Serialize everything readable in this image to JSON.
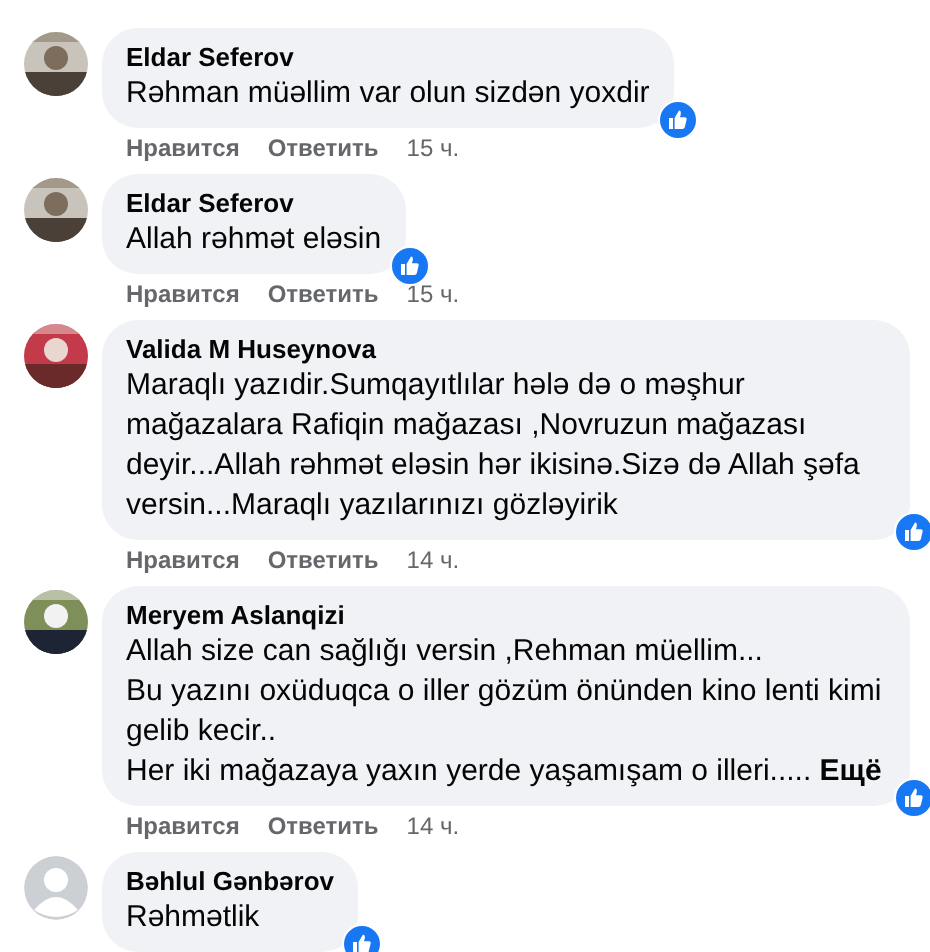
{
  "comments": [
    {
      "author": "Eldar Seferov",
      "photo": true,
      "text": "Rəhman müəllim var olun sizdən yoxdir",
      "liked": true,
      "like": "Нравится",
      "reply": "Ответить",
      "time": "15 ч."
    },
    {
      "author": "Eldar Seferov",
      "photo": true,
      "text": "Allah rəhmət eləsin",
      "liked": true,
      "like": "Нравится",
      "reply": "Ответить",
      "time": "15 ч."
    },
    {
      "author": "Valida M Huseynova",
      "photo": true,
      "text": "Maraqlı yazıdir.Sumqayıtlılar hələ də o məşhur mağazalara Rafiqin mağazası ,Novruzun mağazası deyir...Allah rəhmət eləsin hər ikisinə.Sizə də Allah şəfa versin...Maraqlı yazılarınızı gözləyirik",
      "liked": true,
      "like": "Нравится",
      "reply": "Ответить",
      "time": "14 ч."
    },
    {
      "author": "Meryem Aslanqizi",
      "photo": true,
      "text": "Allah size can sağlığı versin ,Rehman müellim...\nBu yazını oxüduqca o iller gözüm önünden kino lenti kimi gelib kecir..\nHer iki mağazaya yaxın yerde yaşamışam o illeri..... **Ещё**",
      "liked": true,
      "like": "Нравится",
      "reply": "Ответить",
      "time": "14 ч."
    },
    {
      "author": "Bəhlul Gənbərov",
      "photo": false,
      "text": "Rəhmətlik",
      "liked": true
    }
  ]
}
